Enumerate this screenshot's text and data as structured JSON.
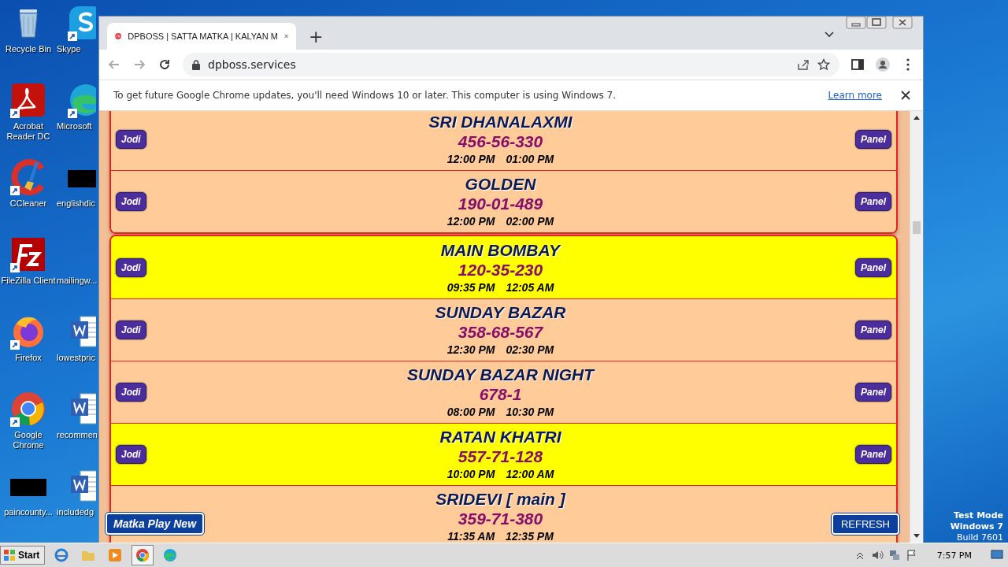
{
  "desktop": {
    "icons": [
      {
        "label": "Recycle Bin",
        "kind": "recycle",
        "shortcut": false
      },
      {
        "label": "Skype",
        "kind": "skype",
        "shortcut": true
      },
      {
        "label": "Acrobat Reader DC",
        "kind": "acrobat",
        "shortcut": true
      },
      {
        "label": "Microsoft",
        "kind": "edge",
        "shortcut": true
      },
      {
        "label": "CCleaner",
        "kind": "ccleaner",
        "shortcut": true
      },
      {
        "label": "englishdic",
        "kind": "blackbox",
        "shortcut": false
      },
      {
        "label": "FileZilla Client",
        "kind": "filezilla",
        "shortcut": true
      },
      {
        "label": "mailingw...",
        "kind": "blank",
        "shortcut": false
      },
      {
        "label": "Firefox",
        "kind": "firefox",
        "shortcut": true
      },
      {
        "label": "lowestpric",
        "kind": "word",
        "shortcut": false
      },
      {
        "label": "Google Chrome",
        "kind": "chrome",
        "shortcut": true
      },
      {
        "label": "recommen",
        "kind": "word",
        "shortcut": false
      },
      {
        "label": "paincounty...",
        "kind": "blackbox",
        "shortcut": false
      },
      {
        "label": "includedg",
        "kind": "word",
        "shortcut": false
      }
    ],
    "watermark_text": [
      "Test Mode",
      "Windows 7",
      "Build 7601"
    ]
  },
  "browser": {
    "tab": {
      "title": "DPBOSS | SATTA MATKA | KALYAN M",
      "selected": true
    },
    "new_tab": "+",
    "address": "dpboss.services",
    "infobar": {
      "message": "To get future Google Chrome updates, you'll need Windows 10 or later. This computer is using Windows 7.",
      "link": "Learn more"
    }
  },
  "page": {
    "cards": [
      {
        "games": [
          {
            "name": "SRI DHANALAXMI",
            "result": "456-56-330",
            "open": "12:00 PM",
            "close": "01:00 PM",
            "highlighted": false,
            "left_button": "Jodi",
            "right_button": "Panel"
          },
          {
            "name": "GOLDEN",
            "result": "190-01-489",
            "open": "12:00 PM",
            "close": "02:00 PM",
            "highlighted": false,
            "left_button": "Jodi",
            "right_button": "Panel"
          }
        ]
      },
      {
        "games": [
          {
            "name": "MAIN BOMBAY",
            "result": "120-35-230",
            "open": "09:35 PM",
            "close": "12:05 AM",
            "highlighted": true,
            "left_button": "Jodi",
            "right_button": "Panel"
          },
          {
            "name": "SUNDAY BAZAR",
            "result": "358-68-567",
            "open": "12:30 PM",
            "close": "02:30 PM",
            "highlighted": false,
            "left_button": "Jodi",
            "right_button": "Panel"
          },
          {
            "name": "SUNDAY BAZAR NIGHT",
            "result": "678-1",
            "open": "08:00 PM",
            "close": "10:30 PM",
            "highlighted": false,
            "left_button": "Jodi",
            "right_button": "Panel"
          },
          {
            "name": "RATAN KHATRI",
            "result": "557-71-128",
            "open": "10:00 PM",
            "close": "12:00 AM",
            "highlighted": true,
            "left_button": "Jodi",
            "right_button": "Panel"
          },
          {
            "name": "SRIDEVI [ main ]",
            "result": "359-71-380",
            "open": "11:35 AM",
            "close": "12:35 PM",
            "highlighted": false
          }
        ]
      }
    ],
    "floating_left": "Matka Play New",
    "floating_right": "REFRESH"
  },
  "taskbar": {
    "start": "Start",
    "clock": "7:57 PM"
  }
}
